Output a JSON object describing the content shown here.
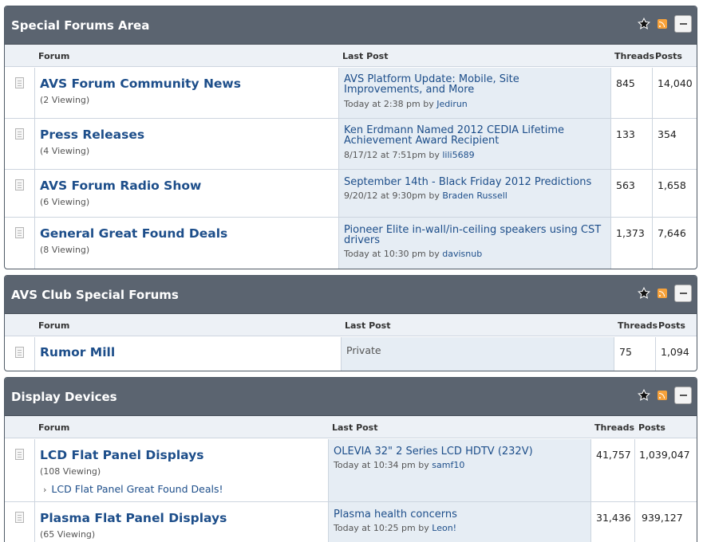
{
  "sections": [
    {
      "title": "Special Forums Area",
      "columns": {
        "forum": "Forum",
        "last_post": "Last Post",
        "threads": "Threads",
        "posts": "Posts"
      },
      "forums": [
        {
          "title": "AVS Forum Community News",
          "viewing": "(2 Viewing)",
          "last_post": {
            "line1": "AVS Platform Update: Mobile, Site",
            "line2": "Improvements, and More",
            "date": "Today at 2:38 pm",
            "by": "by",
            "user": "Jedirun"
          },
          "threads": "845",
          "posts": "14,040"
        },
        {
          "title": "Press Releases",
          "viewing": "(4 Viewing)",
          "last_post": {
            "line1": "Ken Erdmann Named 2012 CEDIA Lifetime",
            "line2": "Achievement Award Recipient",
            "date": "8/17/12 at 7:51pm",
            "by": "by",
            "user": "lili5689"
          },
          "threads": "133",
          "posts": "354"
        },
        {
          "title": "AVS Forum Radio Show",
          "viewing": "(6 Viewing)",
          "last_post": {
            "line1": "September 14th - Black Friday 2012 Predictions",
            "line2": "",
            "date": "9/20/12 at 9:30pm",
            "by": "by",
            "user": "Braden Russell"
          },
          "threads": "563",
          "posts": "1,658"
        },
        {
          "title": "General Great Found Deals",
          "viewing": "(8 Viewing)",
          "last_post": {
            "line1": "Pioneer Elite in-wall/in-ceiling speakers using CST",
            "line2": "drivers",
            "date": "Today at 10:30 pm",
            "by": "by",
            "user": "davisnub"
          },
          "threads": "1,373",
          "posts": "7,646"
        }
      ]
    },
    {
      "title": "AVS Club Special Forums",
      "columns": {
        "forum": "Forum",
        "last_post": "Last Post",
        "threads": "Threads",
        "posts": "Posts"
      },
      "forums": [
        {
          "title": "Rumor Mill",
          "last_post_text": "Private",
          "threads": "75",
          "posts": "1,094"
        }
      ]
    },
    {
      "title": "Display Devices",
      "columns": {
        "forum": "Forum",
        "last_post": "Last Post",
        "threads": "Threads",
        "posts": "Posts"
      },
      "forums": [
        {
          "title": "LCD Flat Panel Displays",
          "viewing": "(108 Viewing)",
          "subforum": "LCD Flat Panel Great Found Deals!",
          "last_post": {
            "line1": "OLEVIA 32\" 2 Series LCD HDTV (232V)",
            "date": "Today at 10:34 pm",
            "by": "by",
            "user": "samf10"
          },
          "threads": "41,757",
          "posts": "1,039,047"
        },
        {
          "title": "Plasma Flat Panel Displays",
          "viewing": "(65 Viewing)",
          "last_post": {
            "line1": "Plasma health concerns",
            "date": "Today at 10:25 pm",
            "by": "by",
            "user": "Leon!"
          },
          "threads": "31,436",
          "posts": "939,127"
        }
      ]
    }
  ],
  "icons": {
    "subscribe": "star-icon",
    "feed": "rss-icon",
    "collapse": "collapse-icon",
    "forum": "forum-doc-icon",
    "subforum": "chevron-right-icon"
  },
  "colors": {
    "header_bg": "#5b6470",
    "column_bg": "#edf1f6",
    "last_post_bg": "#e6edf4",
    "link": "#1d4e8a",
    "rss": "#f7a23b"
  }
}
